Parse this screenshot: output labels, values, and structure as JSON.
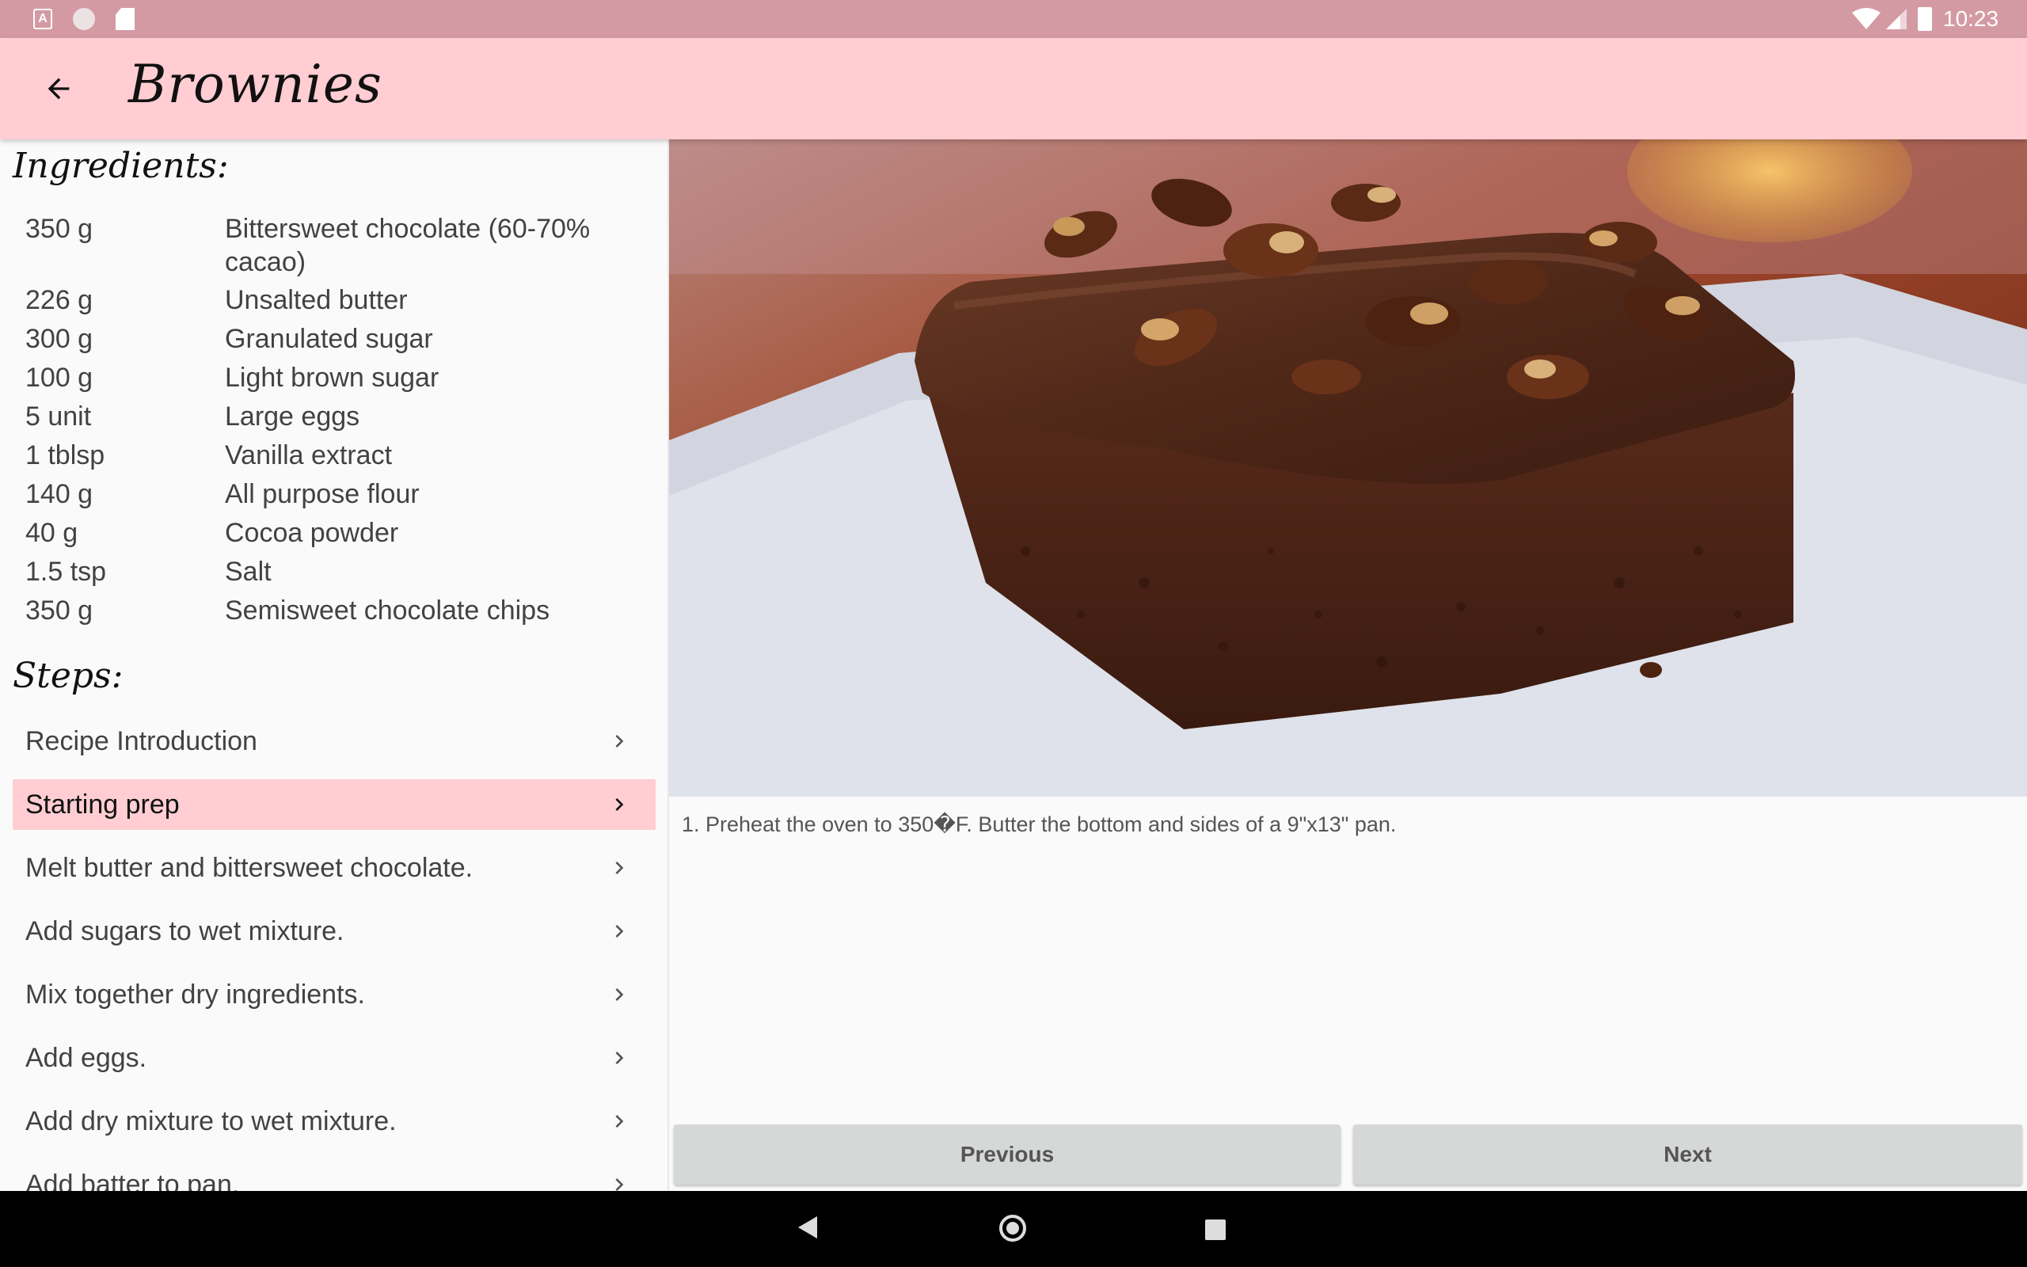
{
  "status_bar": {
    "time": "10:23",
    "notification_icons": [
      "a-notification-icon",
      "circle-notification-icon",
      "sd-card-icon"
    ],
    "system_icons": [
      "wifi-icon",
      "cell-signal-icon",
      "battery-icon"
    ],
    "notification_letter": "A"
  },
  "app_bar": {
    "title": "Brownies",
    "back_icon": "arrow-back-icon"
  },
  "ingredients": {
    "heading": "Ingredients:",
    "items": [
      {
        "qty": "350 g",
        "name": "Bittersweet chocolate (60-70% cacao)"
      },
      {
        "qty": "226 g",
        "name": "Unsalted butter"
      },
      {
        "qty": "300 g",
        "name": "Granulated sugar"
      },
      {
        "qty": "100 g",
        "name": "Light brown sugar"
      },
      {
        "qty": "5 unit",
        "name": "Large eggs"
      },
      {
        "qty": "1 tblsp",
        "name": "Vanilla extract"
      },
      {
        "qty": "140 g",
        "name": "All purpose flour"
      },
      {
        "qty": "40 g",
        "name": "Cocoa powder"
      },
      {
        "qty": "1.5 tsp",
        "name": "Salt"
      },
      {
        "qty": "350 g",
        "name": "Semisweet chocolate chips"
      }
    ]
  },
  "steps": {
    "heading": "Steps:",
    "selected_index": 1,
    "items": [
      {
        "label": "Recipe Introduction"
      },
      {
        "label": "Starting prep"
      },
      {
        "label": "Melt butter and bittersweet chocolate."
      },
      {
        "label": "Add sugars to wet mixture."
      },
      {
        "label": "Mix together dry ingredients."
      },
      {
        "label": "Add eggs."
      },
      {
        "label": "Add dry mixture to wet mixture."
      },
      {
        "label": "Add batter to pan."
      }
    ]
  },
  "detail": {
    "description": "1. Preheat the oven to 350�F. Butter the bottom and sides of a 9\"x13\" pan.",
    "previous_label": "Previous",
    "next_label": "Next"
  },
  "colors": {
    "status_bar": "#d49aa3",
    "app_bar": "#ffcdd2",
    "selected_step": "#ffcdd2",
    "button": "#d6d7d7"
  }
}
